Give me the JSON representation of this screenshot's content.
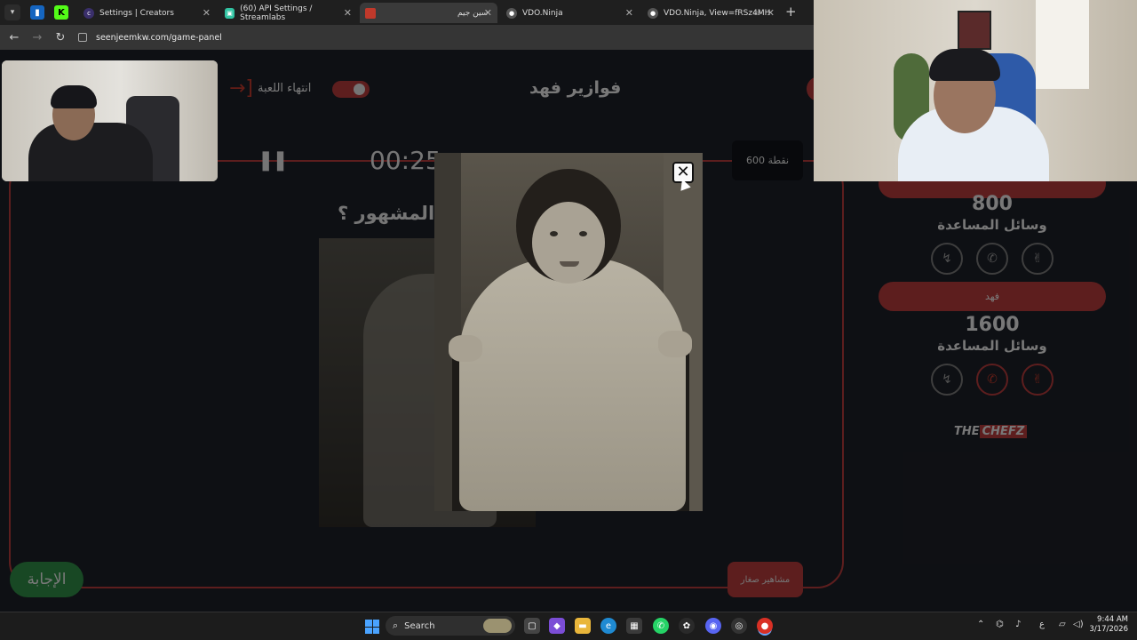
{
  "browser": {
    "tabs": [
      {
        "label": "Settings | Creators",
        "icon": "creators-c-icon"
      },
      {
        "label": "(60) API Settings / Streamlabs",
        "icon": "streamlabs-icon"
      },
      {
        "label": "سين جيم",
        "icon": "seenjeem-icon"
      },
      {
        "label": "VDO.Ninja",
        "icon": "vdo-ninja-icon"
      },
      {
        "label": "VDO.Ninja, View=fRSz4MH",
        "icon": "vdo-ninja-icon"
      }
    ],
    "url": "seenjeemkw.com/game-panel"
  },
  "game": {
    "title": "فوازير فهد",
    "end_game_label": "انتهاء اللعبة",
    "timer": "00:25",
    "points_badge": "600 نقطة",
    "question": "المشهور ؟",
    "answer_button": "الإجابة",
    "zero_button": "مشاهير صغار"
  },
  "teams": [
    {
      "name": "",
      "score": "800",
      "helps_label": "وسائل المساعدة"
    },
    {
      "name": "فهد",
      "score": "1600",
      "helps_label": "وسائل المساعدة"
    }
  ],
  "sponsor": {
    "part1": "THE",
    "part2": "CHEFZ"
  },
  "modal": {
    "close_symbol": "✕"
  },
  "taskbar": {
    "search_placeholder": "Search",
    "time": "9:44 AM",
    "date": "3/17/2026",
    "lang": "ع"
  },
  "colors": {
    "accent": "#b33a3a",
    "answer_green": "#2e8b45",
    "page_bg": "#1c1f27"
  }
}
